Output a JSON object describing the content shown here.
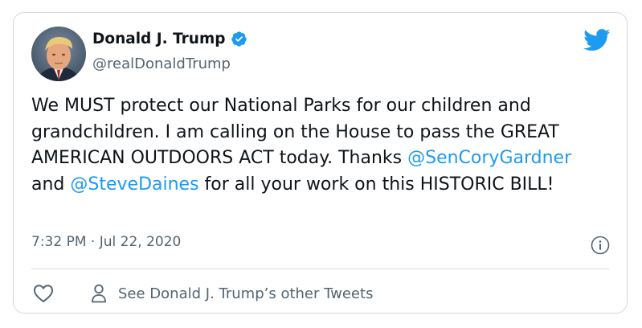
{
  "tweet": {
    "author_name": "Donald J. Trump",
    "handle": "@realDonaldTrump",
    "text_segments": [
      "We MUST protect our National Parks for our children and grandchildren. I am calling on the House to pass the GREAT AMERICAN OUTDOORS ACT today. Thanks ",
      "@SenCoryGardner",
      " and ",
      "@SteveDaines",
      " for all your work on this HISTORIC BILL!"
    ],
    "timestamp": "7:32 PM · Jul 22, 2020",
    "see_other_tweets": "See Donald J. Trump’s other Tweets"
  },
  "icons": {
    "logo": "twitter-bird-icon",
    "verified": "verified-badge-icon",
    "info": "info-icon",
    "like": "heart-icon",
    "profile": "person-icon"
  },
  "colors": {
    "accent": "#1d9bf0",
    "secondary_text": "#536471",
    "primary_text": "#0f1419",
    "border": "#cfd9de"
  }
}
